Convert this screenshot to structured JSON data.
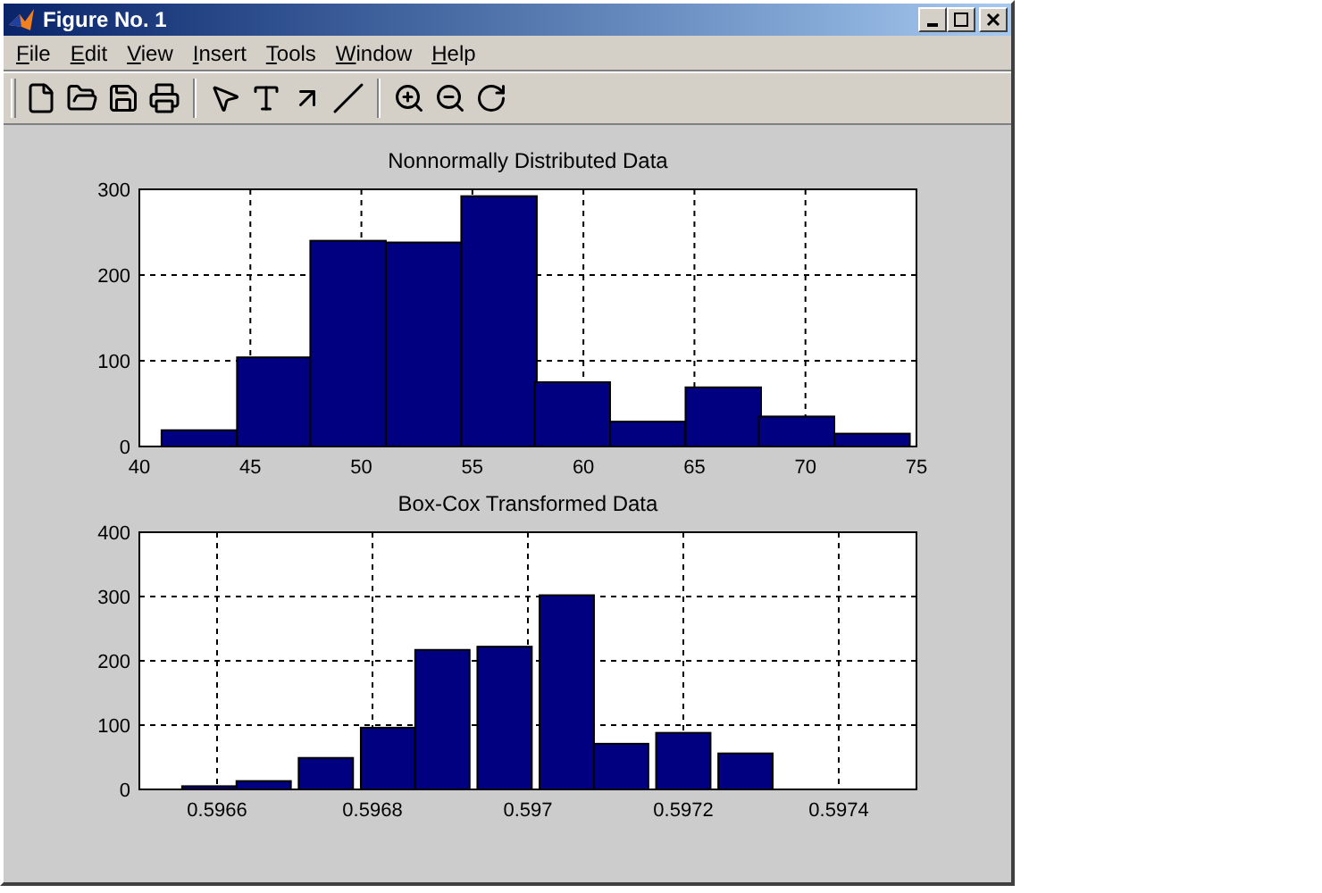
{
  "window": {
    "title": "Figure No. 1"
  },
  "menu": [
    "File",
    "Edit",
    "View",
    "Insert",
    "Tools",
    "Window",
    "Help"
  ],
  "charts": [
    {
      "chart_data": {
        "type": "bar",
        "title": "Nonnormally Distributed Data",
        "x": [
          42.7,
          46.1,
          49.4,
          52.8,
          56.2,
          59.5,
          62.9,
          66.3,
          69.6,
          73.0
        ],
        "values": [
          19,
          104,
          240,
          238,
          292,
          75,
          29,
          69,
          35,
          15
        ],
        "xlim": [
          40,
          75
        ],
        "ylim": [
          0,
          300
        ],
        "xticks": [
          40,
          45,
          50,
          55,
          60,
          65,
          70,
          75
        ],
        "yticks": [
          0,
          100,
          200,
          300
        ],
        "grid": true
      }
    },
    {
      "chart_data": {
        "type": "bar",
        "title": "Box-Cox Transformed Data",
        "x": [
          0.59659,
          0.59666,
          0.59674,
          0.59682,
          0.59689,
          0.59697,
          0.59705,
          0.59712,
          0.5972,
          0.59728
        ],
        "values": [
          5,
          13,
          49,
          96,
          217,
          222,
          302,
          71,
          88,
          56
        ],
        "xlim": [
          0.5965,
          0.5975
        ],
        "ylim": [
          0,
          400
        ],
        "xticks": [
          0.5966,
          0.5968,
          0.597,
          0.5972,
          0.5974
        ],
        "yticks": [
          0,
          100,
          200,
          300,
          400
        ],
        "grid": true
      }
    }
  ]
}
